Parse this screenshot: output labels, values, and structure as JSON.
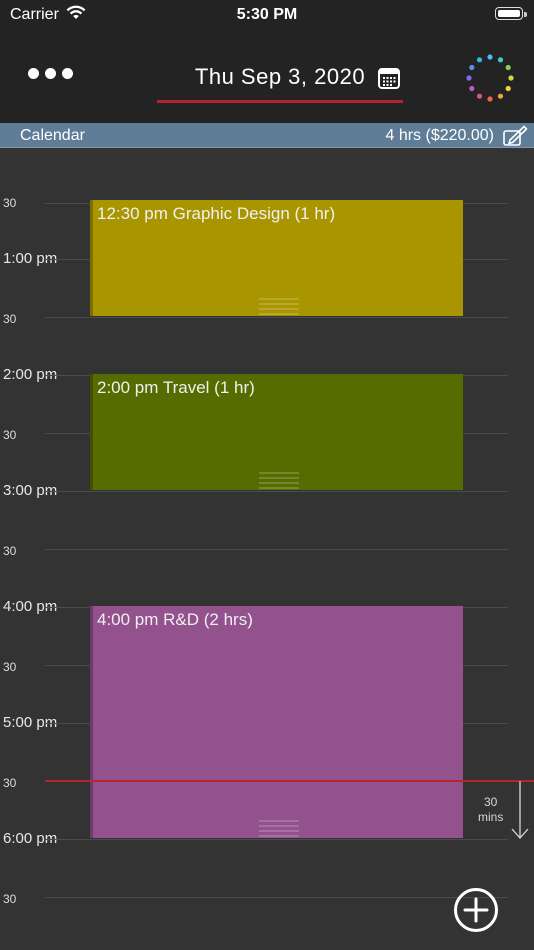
{
  "status_bar": {
    "carrier": "Carrier",
    "time": "5:30 PM"
  },
  "nav": {
    "date_title": "Thu Sep 3, 2020",
    "accent_color": "#b0242a"
  },
  "banner": {
    "title": "Calendar",
    "total": "4 hrs ($220.00)",
    "background": "#5f7d96"
  },
  "timeline": {
    "labels": {
      "t1230": "30",
      "t100": "1:00 pm",
      "t130": "30",
      "t200": "2:00 pm",
      "t230": "30",
      "t300": "3:00 pm",
      "t330": "30",
      "t400": "4:00 pm",
      "t430": "30",
      "t500": "5:00 pm",
      "t530": "30",
      "t600": "6:00 pm",
      "t630": "30"
    },
    "interval_value": "30",
    "interval_unit": "mins"
  },
  "events": [
    {
      "label": "12:30 pm Graphic Design (1 hr)",
      "color": "#a89500"
    },
    {
      "label": "2:00 pm Travel (1 hr)",
      "color": "#566c00"
    },
    {
      "label": "4:00 pm R&D (2 hrs)",
      "color": "#93518e"
    }
  ],
  "icons": {
    "more": "ellipsis-icon",
    "calendar": "calendar-icon",
    "colors": "color-wheel-icon",
    "edit": "edit-icon",
    "add": "add-circle-icon",
    "interval": "down-arrow-icon"
  }
}
